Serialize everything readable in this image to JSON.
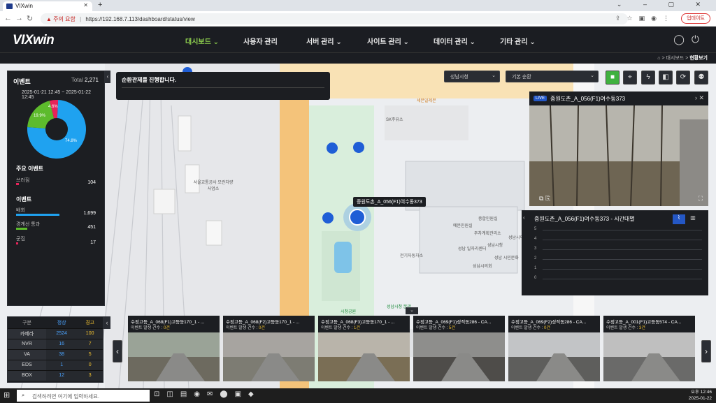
{
  "browser": {
    "tab_title": "VIXwin",
    "security_warning": "주의 요함",
    "url": "https://192.168.7.113/dashboard/status/view",
    "update_button": "업데이트"
  },
  "app": {
    "logo": "VIXwin",
    "menu": [
      "대시보드",
      "사용자 관리",
      "서버 관리",
      "사이트 관리",
      "데이터 관리",
      "기타 관리"
    ],
    "active_menu": "대시보드",
    "breadcrumb": {
      "path": "대시보드 >",
      "current": "현황보기"
    }
  },
  "events": {
    "title": "이벤트",
    "total_label": "Total",
    "total_value": "2,271",
    "date_range": "2025-01-21 12:45 ~ 2025-01-22 12:45",
    "pie": [
      {
        "label": "74.8%",
        "value": 74.8,
        "color": "#1fa2f0"
      },
      {
        "label": "19.9%",
        "value": 19.9,
        "color": "#5dbb2c"
      },
      {
        "label": "4.6%",
        "value": 4.6,
        "color": "#e8235a"
      }
    ],
    "major_title": "주요 이벤트",
    "major": [
      {
        "label": "쓰러짐",
        "value": "104",
        "color": "#e8235a",
        "fraction": 0.05
      }
    ],
    "event_title": "이벤트",
    "items": [
      {
        "label": "배회",
        "value": "1,699",
        "color": "#1fa2f0",
        "fraction": 0.75
      },
      {
        "label": "경계선 통과",
        "value": "451",
        "color": "#5dbb2c",
        "fraction": 0.2
      },
      {
        "label": "군집",
        "value": "17",
        "color": "#e8235a",
        "fraction": 0.02
      }
    ]
  },
  "notice": "순환관제를 진행합니다.",
  "selects": {
    "region": "성남시청",
    "mode": "기본 순환"
  },
  "toolbar_icons": [
    "stop-icon",
    "map-pin-icon",
    "flash-icon",
    "camera-icon",
    "refresh-icon",
    "person-icon"
  ],
  "map": {
    "tooltip": "중원도촌_A_056(F1)여수동373",
    "labels": [
      "세븐일레븐",
      "SK주유소",
      "서울교통공사 모란차량사업소",
      "종합민원실",
      "예문민원실",
      "주차계획관리소",
      "성남시의회",
      "성남시청",
      "성남 일자리센터",
      "성남시의회 의원회관",
      "성남 시민문화",
      "전기자동차소",
      "성남시청 본관",
      "시청공원"
    ]
  },
  "live": {
    "badge": "LIVE",
    "title": "중원도촌_A_056(F1)여수동373"
  },
  "timeseries": {
    "title": "중원도촌_A_056(F1)여수동373 - 시간대별",
    "y_ticks": [
      "5",
      "4",
      "3",
      "2",
      "1",
      "0"
    ]
  },
  "stats": {
    "headers": [
      "구분",
      "정상",
      "경고"
    ],
    "rows": [
      {
        "label": "카메라",
        "normal": "2524",
        "warn": "100"
      },
      {
        "label": "NVR",
        "normal": "16",
        "warn": "7"
      },
      {
        "label": "VA",
        "normal": "38",
        "warn": "5"
      },
      {
        "label": "EDS",
        "normal": "1",
        "warn": "0"
      },
      {
        "label": "BOX",
        "normal": "12",
        "warn": "3"
      }
    ]
  },
  "cameras": [
    {
      "title": "수정고등_A_068(F1)고등동170_1 - ...",
      "count_label": "이벤트 발생 건수 :",
      "count": "0건"
    },
    {
      "title": "수정고등_A_068(F2)고등동170_1 - ...",
      "count_label": "이벤트 발생 건수 :",
      "count": "0건"
    },
    {
      "title": "수정고등_A_068(F3)고등동170_1 - ...",
      "count_label": "이벤트 발생 건수 :",
      "count": "1건"
    },
    {
      "title": "수정고등_A_069(F1)성적동286 - CA...",
      "count_label": "이벤트 발생 건수 :",
      "count": "5건"
    },
    {
      "title": "수정고등_A_069(F2)성적동286 - CA...",
      "count_label": "이벤트 발생 건수 :",
      "count": "0건"
    },
    {
      "title": "수정고등_A_001(F1)고등동574 - CA...",
      "count_label": "이벤트 발생 건수 :",
      "count": "3건"
    }
  ],
  "taskbar": {
    "search_placeholder": "검색하려면 여기에 입력하세요.",
    "time": "오후 12:46",
    "date": "2025-01-22"
  }
}
